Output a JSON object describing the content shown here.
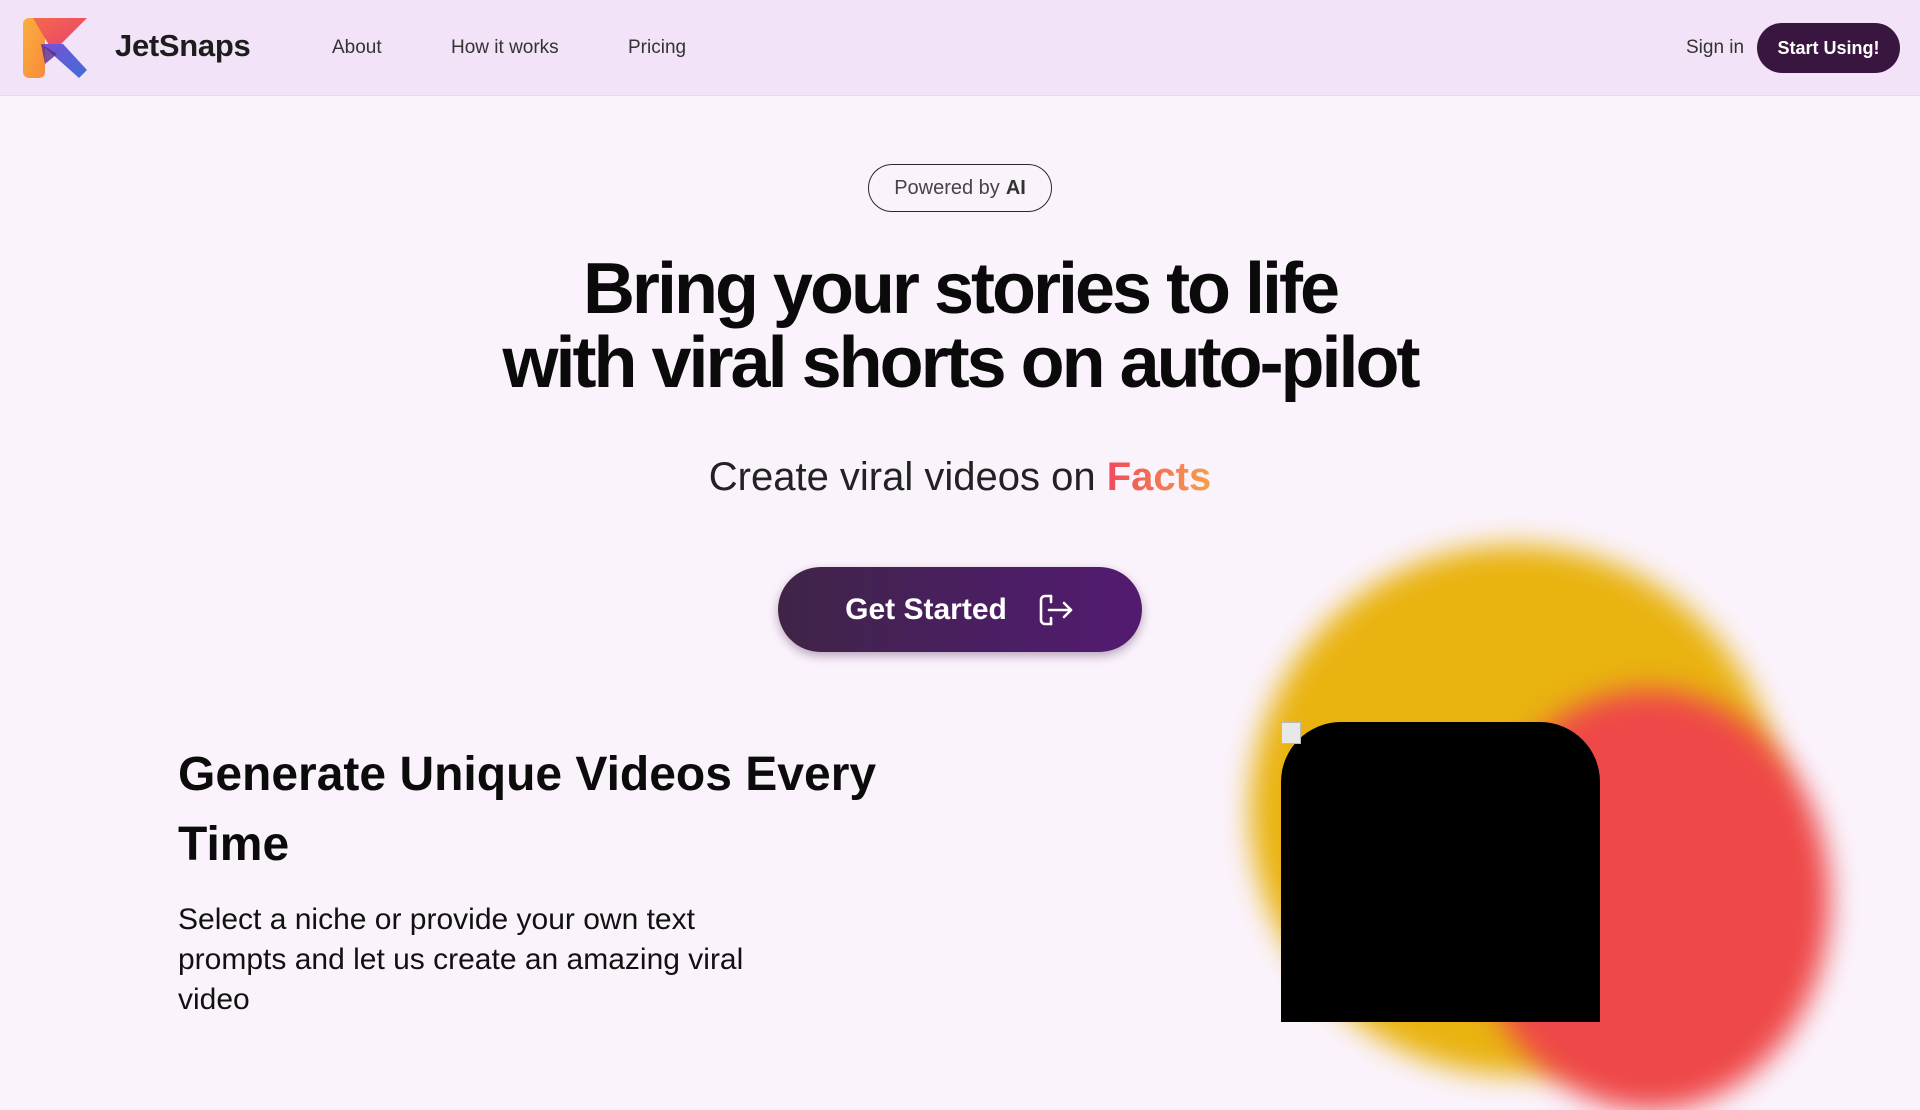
{
  "header": {
    "brand": "JetSnaps",
    "nav": [
      "About",
      "How it works",
      "Pricing"
    ],
    "sign_in": "Sign in",
    "cta": "Start Using!"
  },
  "hero": {
    "badge_prefix": "Powered by",
    "badge_bold": "AI",
    "headline_line1": "Bring your stories to life",
    "headline_line2": "with viral shorts on auto-pilot",
    "sub_prefix": "Create viral videos on",
    "sub_accent": "Facts",
    "button": "Get Started"
  },
  "feature": {
    "title": "Generate Unique Videos Every Time",
    "description": "Select a niche or provide your own text prompts and let us create an amazing viral video"
  },
  "colors": {
    "topbar": "#f2e3f8",
    "page_bg": "#fbf3fc",
    "primary_dark": "#381640",
    "accent_gradient_start": "#f04a5e",
    "accent_gradient_end": "#f5a04a",
    "blob_yellow": "#e9b310",
    "blob_red": "#ee4848"
  },
  "icons": {
    "logo": "jetsnaps-logo-icon",
    "cta_arrow": "sign-in-arrow-icon",
    "broken_image": "broken-image-icon"
  }
}
